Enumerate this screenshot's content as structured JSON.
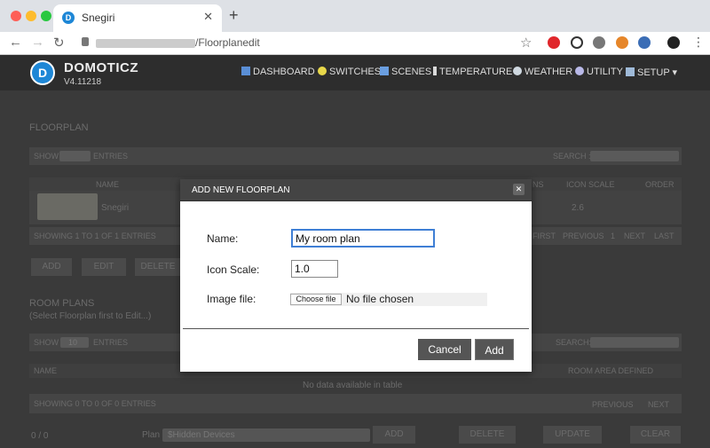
{
  "browser": {
    "tab_title": "Snegiri",
    "tab_close": "✕",
    "new_tab": "+",
    "url_visible": "/Floorplanedit",
    "back": "←",
    "forward": "→",
    "reload": "↻",
    "bookmark": "☆",
    "menu": "⋮"
  },
  "app": {
    "brand": "DOMOTICZ",
    "version": "V4.11218",
    "logo_letter": "D",
    "nav": [
      {
        "label": "DASHBOARD",
        "icon": "dashboard-icon"
      },
      {
        "label": "SWITCHES",
        "icon": "lightbulb-icon"
      },
      {
        "label": "SCENES",
        "icon": "scenes-icon"
      },
      {
        "label": "TEMPERATURE",
        "icon": "thermometer-icon"
      },
      {
        "label": "WEATHER",
        "icon": "weather-icon"
      },
      {
        "label": "UTILITY",
        "icon": "utility-icon"
      },
      {
        "label": "SETUP ▾",
        "icon": "setup-icon"
      }
    ]
  },
  "background": {
    "floorplan_title": "FLOORPLAN",
    "show": "SHOW",
    "entries": "ENTRIES",
    "search": "SEARCH :",
    "col_name": "NAME",
    "col_ns": "NS",
    "col_icon_scale": "ICON SCALE",
    "col_order": "ORDER",
    "row_name": "Snegiri",
    "row_scale": "2.6",
    "showing1": "SHOWING 1 TO 1 OF 1 ENTRIES",
    "pager1": [
      "FIRST",
      "PREVIOUS",
      "1",
      "NEXT",
      "LAST"
    ],
    "btn_add": "ADD",
    "btn_edit": "EDIT",
    "btn_delete": "DELETE",
    "room_title": "ROOM PLANS",
    "room_sub": "(Select Floorplan first to Edit...)",
    "show_count": "10",
    "search2": "SEARCH:",
    "col_name2": "NAME",
    "col_room_area": "ROOM AREA DEFINED",
    "no_data": "No data available in table",
    "showing2": "SHOWING 0 TO 0 OF 0 ENTRIES",
    "pager2": [
      "PREVIOUS",
      "NEXT"
    ],
    "counter": "0 / 0",
    "plan_label": "Plan",
    "plan_value": "$Hidden Devices",
    "btn_add2": "ADD",
    "btn_delete2": "DELETE",
    "btn_update": "UPDATE",
    "btn_clear": "CLEAR"
  },
  "modal": {
    "title": "ADD NEW FLOORPLAN",
    "close": "✕",
    "name_label": "Name:",
    "name_value": "My room plan",
    "scale_label": "Icon Scale:",
    "scale_value": "1.0",
    "image_label": "Image file:",
    "choose_label": "Choose file",
    "no_file": "No file chosen",
    "cancel": "Cancel",
    "add": "Add"
  }
}
